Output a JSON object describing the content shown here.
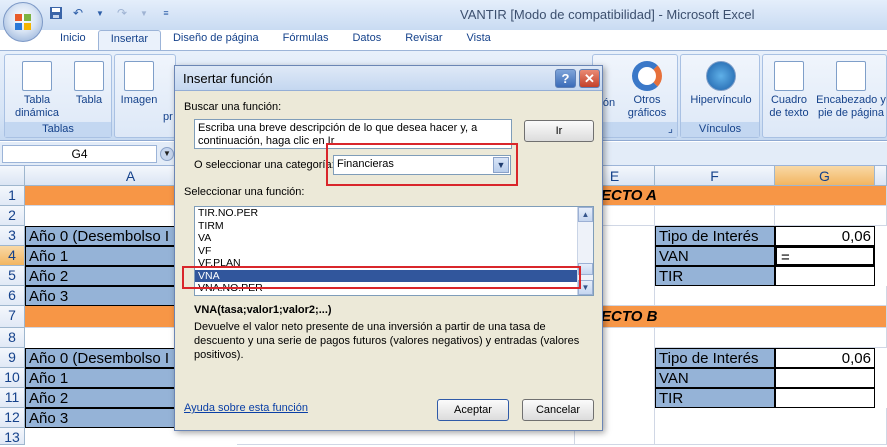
{
  "window": {
    "title": "VANTIR  [Modo de compatibilidad] - Microsoft Excel"
  },
  "ribbon_tabs": [
    "Inicio",
    "Insertar",
    "Diseño de página",
    "Fórmulas",
    "Datos",
    "Revisar",
    "Vista"
  ],
  "active_tab": "Insertar",
  "ribbon": {
    "tablas_group": "Tablas",
    "tabla_dinamica": "Tabla dinámica",
    "tabla": "Tabla",
    "imagen": "Imagen",
    "pr_partial": "pr",
    "on_partial": "ón",
    "otros_graficos": "Otros gráficos",
    "hipervinculo": "Hipervínculo",
    "vinculos_group": "Vínculos",
    "cuadro_texto": "Cuadro de texto",
    "encabezado": "Encabezado y pie de página"
  },
  "formula_bar": {
    "name_box": "G4"
  },
  "sheet": {
    "columns": [
      "A",
      "E",
      "F",
      "G"
    ],
    "rows": [
      "1",
      "2",
      "3",
      "4",
      "5",
      "6",
      "7",
      "8",
      "9",
      "10",
      "11",
      "12",
      "13"
    ],
    "cells": {
      "a3": "Año 0 (Desembolso I",
      "a4": "Año 1",
      "a5": "Año 2",
      "a6": "Año 3",
      "a9": "Año 0 (Desembolso I",
      "a10": "Año 1",
      "a11": "Año 2",
      "a12": "Año 3",
      "e1": "ECTO A",
      "e7": "ECTO B",
      "f3": "Tipo de Interés",
      "g3": "0,06",
      "f4": "VAN",
      "g4": "=",
      "f5": "TIR",
      "f9": "Tipo de Interés",
      "g9": "0,06",
      "f10": "VAN",
      "f11": "TIR"
    },
    "colors": {
      "orange": "#f79646",
      "blue": "#95b3d7"
    }
  },
  "dialog": {
    "title": "Insertar función",
    "search_label": "Buscar una función:",
    "search_text": "Escriba una breve descripción de lo que desea hacer y, a continuación, haga clic en Ir",
    "go_button": "Ir",
    "category_label": "O seleccionar una categoría:",
    "category_value": "Financieras",
    "select_label": "Seleccionar una función:",
    "functions": [
      "TIR.NO.PER",
      "TIRM",
      "VA",
      "VF",
      "VF.PLAN",
      "VNA",
      "VNA.NO.PER"
    ],
    "selected_function": "VNA",
    "syntax": "VNA(tasa;valor1;valor2;...)",
    "description": "Devuelve el valor neto presente de una inversión a partir de una tasa de descuento y una serie de pagos futuros (valores negativos) y entradas (valores positivos).",
    "help_link": "Ayuda sobre esta función",
    "ok_button": "Aceptar",
    "cancel_button": "Cancelar",
    "help_icon": "?",
    "close_icon": "✕"
  }
}
